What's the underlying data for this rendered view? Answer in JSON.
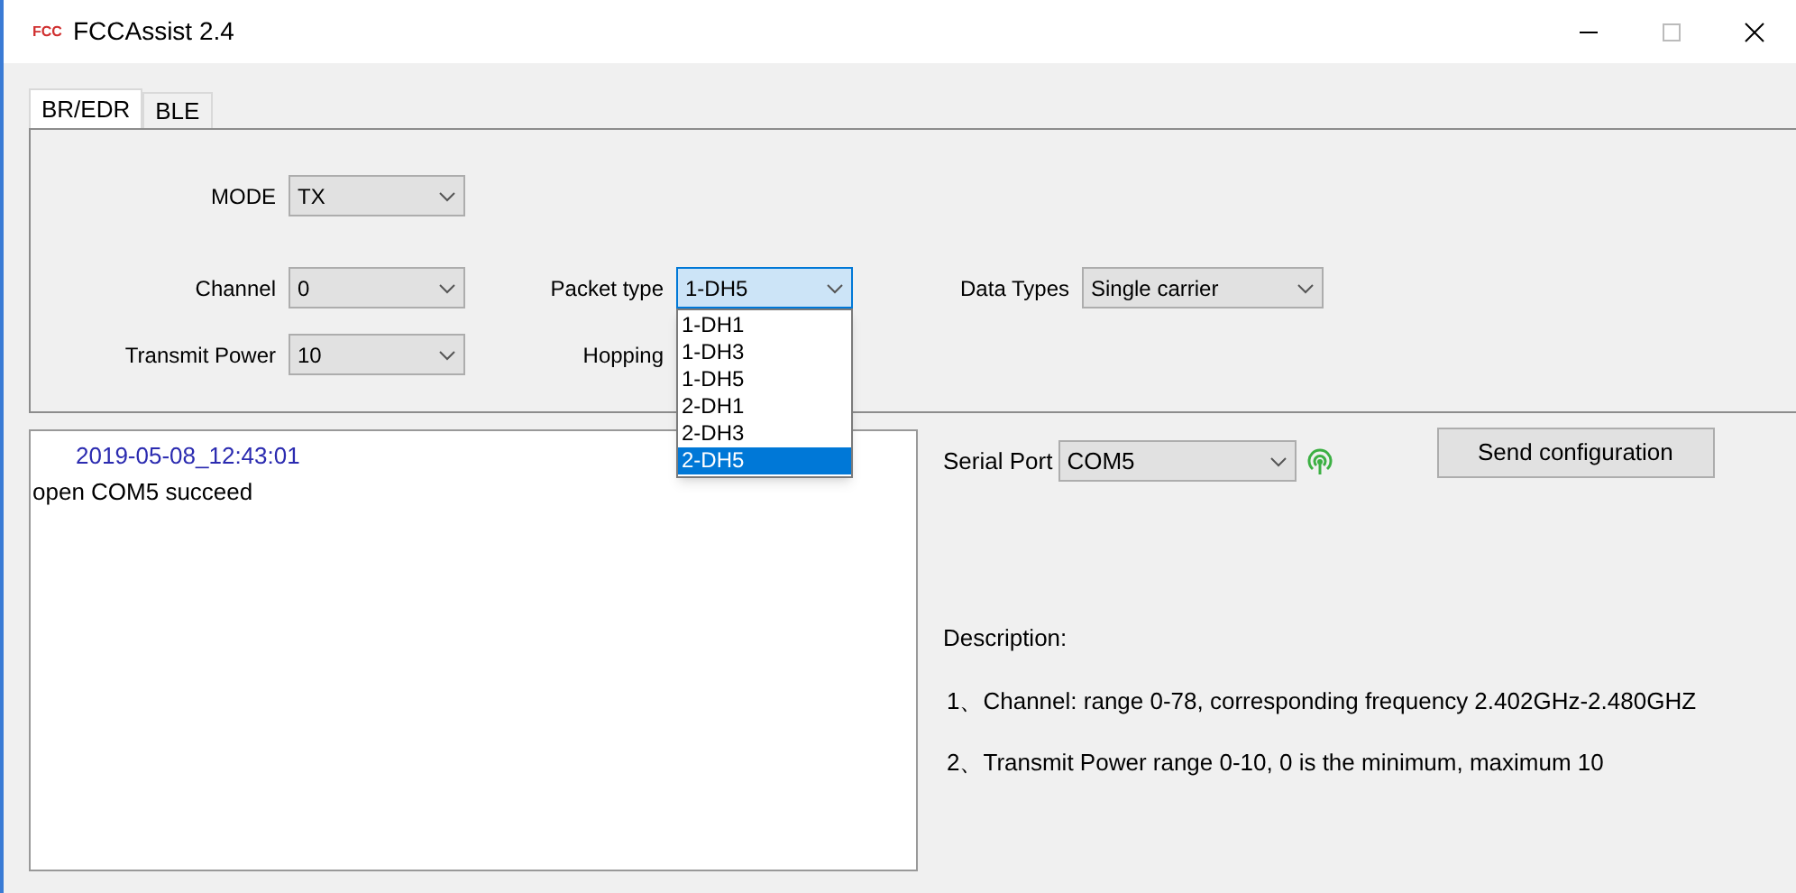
{
  "window": {
    "title": "FCCAssist 2.4",
    "logo": "FCC"
  },
  "tabs": [
    {
      "label": "BR/EDR",
      "selected": true
    },
    {
      "label": "BLE",
      "selected": false
    }
  ],
  "form": {
    "mode": {
      "label": "MODE",
      "value": "TX"
    },
    "channel": {
      "label": "Channel",
      "value": "0"
    },
    "transmit_power": {
      "label": "Transmit Power",
      "value": "10"
    },
    "packet_type": {
      "label": "Packet type",
      "value": "1-DH5",
      "expanded": true,
      "options": [
        {
          "label": "1-DH1",
          "highlighted": false
        },
        {
          "label": "1-DH3",
          "highlighted": false
        },
        {
          "label": "1-DH5",
          "highlighted": false
        },
        {
          "label": "2-DH1",
          "highlighted": false
        },
        {
          "label": "2-DH3",
          "highlighted": false
        },
        {
          "label": "2-DH5",
          "highlighted": true
        }
      ]
    },
    "hopping": {
      "label": "Hopping"
    },
    "data_types": {
      "label": "Data Types",
      "value": "Single carrier"
    }
  },
  "log": [
    {
      "kind": "timestamp",
      "text": "2019-05-08_12:43:01"
    },
    {
      "kind": "message",
      "text": "open COM5 succeed"
    }
  ],
  "serial_port": {
    "label": "Serial Port",
    "value": "COM5"
  },
  "send_button": "Send configuration",
  "description": {
    "title": "Description:",
    "lines": [
      "1、Channel: range 0-78, corresponding frequency 2.402GHz-2.480GHZ",
      "2、Transmit Power  range 0-10, 0 is the minimum, maximum 10"
    ]
  }
}
